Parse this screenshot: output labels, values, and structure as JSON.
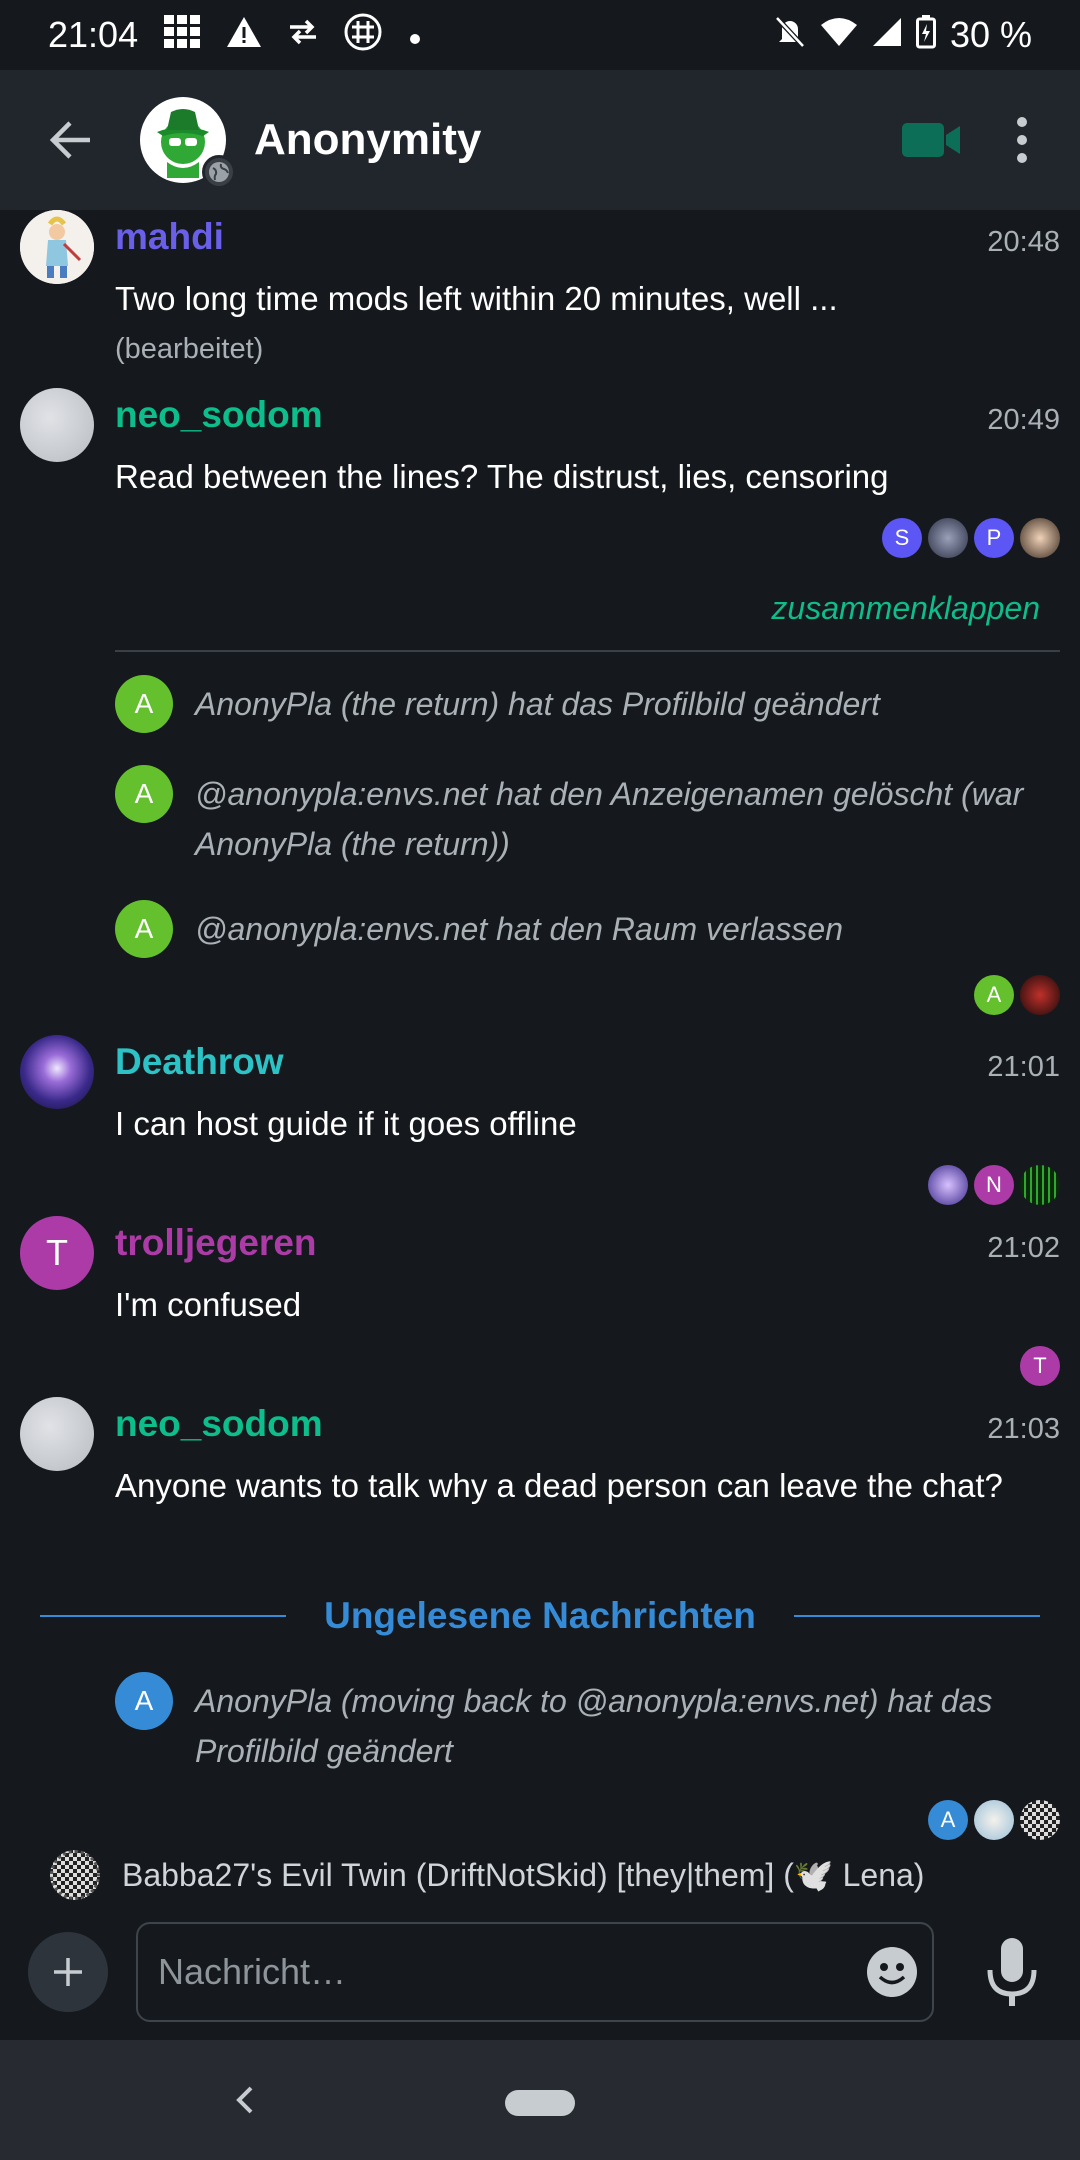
{
  "status_bar": {
    "time": "21:04",
    "battery": "30 %",
    "icons": [
      "grid-icon",
      "warning-icon",
      "transfer-icon",
      "hashtag-icon",
      "dot-icon",
      "mute-icon",
      "wifi-icon",
      "signal-icon",
      "battery-icon"
    ]
  },
  "header": {
    "room_name": "Anonymity",
    "back_icon": "arrow-left-icon",
    "video_icon": "video-call-icon",
    "menu_icon": "more-vert-icon",
    "colors": {
      "video": "#0d6e57",
      "bar": "#21262c"
    }
  },
  "messages": [
    {
      "sender": "mahdi",
      "sender_color": "#6a5fe8",
      "time": "20:48",
      "text": "Two long time mods left within 20 minutes, well ...",
      "edited": "(bearbeitet)"
    },
    {
      "sender": "neo_sodom",
      "sender_color": "#0dbd8b",
      "time": "20:49",
      "text": "Read between the lines? The distrust, lies, censoring",
      "receipts": [
        "S",
        "",
        "P",
        ""
      ]
    },
    {
      "sender": "Deathrow",
      "sender_color": "#2dc2c5",
      "time": "21:01",
      "text": "I can host guide if it goes offline",
      "receipts": [
        "",
        "N",
        ""
      ]
    },
    {
      "sender": "trolljegeren",
      "sender_color": "#ac3ba8",
      "time": "21:02",
      "text": "I'm confused",
      "avatar_letter": "T",
      "receipts": [
        "T"
      ]
    },
    {
      "sender": "neo_sodom",
      "sender_color": "#0dbd8b",
      "time": "21:03",
      "text": "Anyone wants to talk why a dead person can leave the chat?"
    }
  ],
  "collapse_label": "zusammenklappen",
  "events": [
    {
      "avatar_letter": "A",
      "text": "AnonyPla (the return) hat das Profilbild geändert"
    },
    {
      "avatar_letter": "A",
      "text": "@anonypla:envs.net hat den Anzeigenamen gelöscht (war AnonyPla (the return))"
    },
    {
      "avatar_letter": "A",
      "text": "@anonypla:envs.net hat den Raum verlassen"
    }
  ],
  "events_receipts": [
    "A",
    ""
  ],
  "unread_label": "Ungelesene Nachrichten",
  "unread_event": {
    "avatar_letter": "A",
    "text": "AnonyPla (moving back to @anonypla:envs.net) hat das Profilbild geändert"
  },
  "unread_receipts": [
    "A",
    "",
    ""
  ],
  "typing": {
    "text": "Babba27's Evil Twin (DriftNotSkid) [they|them] (🕊️ Lena)"
  },
  "composer": {
    "placeholder": "Nachricht…"
  }
}
